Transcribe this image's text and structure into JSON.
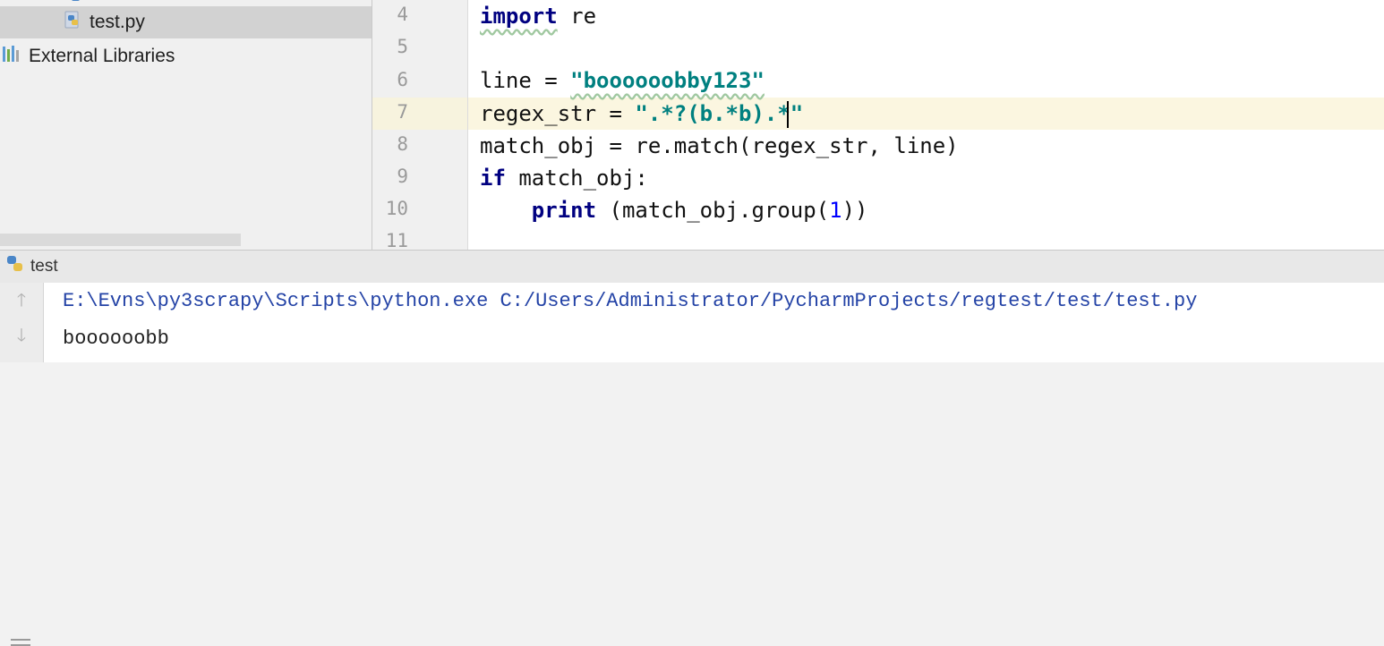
{
  "project_tree": {
    "cut_item": "",
    "file_item": "test.py",
    "libraries_item": "External Libraries"
  },
  "editor": {
    "line_numbers": [
      "4",
      "5",
      "6",
      "7",
      "8",
      "9",
      "10",
      "11"
    ],
    "code": {
      "l4_kw": "import",
      "l4_rest": " re",
      "l6_lhs": "line = ",
      "l6_str": "\"boooooobby123\"",
      "l7_lhs": "regex_str = ",
      "l7_str_a": "\".*?(b.*b).*",
      "l7_str_b": "\"",
      "l8": "match_obj = re.match(regex_str, line)",
      "l9_kw": "if",
      "l9_rest": " match_obj:",
      "l10_indent": "    ",
      "l10_fn": "print",
      "l10_mid": " (match_obj.group(",
      "l10_num": "1",
      "l10_end": "))"
    }
  },
  "run_panel": {
    "tab_label": "test",
    "command": "E:\\Evns\\py3scrapy\\Scripts\\python.exe C:/Users/Administrator/PycharmProjects/regtest/test/test.py",
    "output": "boooooobb",
    "up_icon": "arrow-up-icon",
    "down_icon": "arrow-down-icon"
  },
  "colors": {
    "keyword": "#000080",
    "string": "#008080",
    "number": "#0000ff",
    "console_command": "#2443a6",
    "current_line": "#fbf6e0"
  }
}
